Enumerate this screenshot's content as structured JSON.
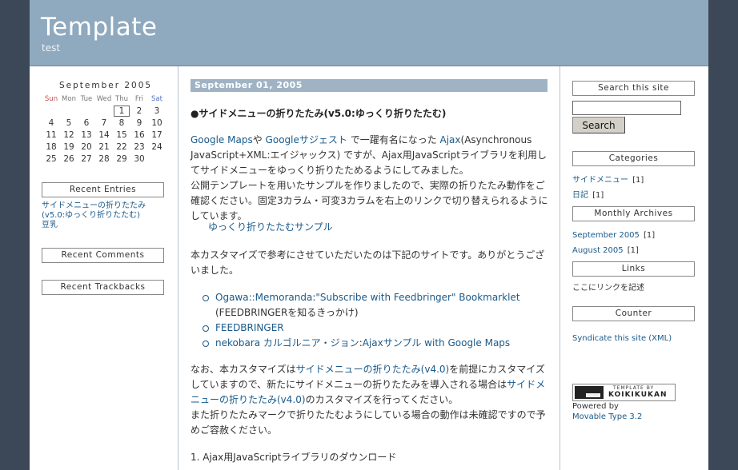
{
  "site": {
    "title": "Template",
    "description": "test"
  },
  "calendar": {
    "caption": "September 2005",
    "weekdays": [
      "Sun",
      "Mon",
      "Tue",
      "Wed",
      "Thu",
      "Fri",
      "Sat"
    ],
    "weeks": [
      [
        "",
        "",
        "",
        "",
        "1",
        "2",
        "3"
      ],
      [
        "4",
        "5",
        "6",
        "7",
        "8",
        "9",
        "10"
      ],
      [
        "11",
        "12",
        "13",
        "14",
        "15",
        "16",
        "17"
      ],
      [
        "18",
        "19",
        "20",
        "21",
        "22",
        "23",
        "24"
      ],
      [
        "25",
        "26",
        "27",
        "28",
        "29",
        "30",
        ""
      ]
    ],
    "highlighted_day": "1"
  },
  "left": {
    "recent_entries_title": "Recent Entries",
    "recent_entries": [
      "サイドメニューの折りたたみ(v5.0:ゆっくり折りたたむ)",
      "豆乳"
    ],
    "recent_comments_title": "Recent Comments",
    "recent_trackbacks_title": "Recent Trackbacks"
  },
  "post": {
    "date": "September 01, 2005",
    "title": "●サイドメニューの折りたたみ(v5.0:ゆっくり折りたたむ)",
    "p1": {
      "link1": "Google Maps",
      "t1": "や ",
      "link2": "Googleサジェスト",
      "t2": " で一躍有名になった ",
      "link3": "Ajax",
      "t3": "(Asynchronous JavaScript+XML:エイジャックス) ですが、Ajax用JavaScriptライブラリを利用してサイドメニューをゆっくり折りたためるようにしてみました。",
      "t4": "公開テンプレートを用いたサンプルを作りましたので、実際の折りたたみ動作をご確認ください。固定3カラム・可変3カラムを右上のリンクで切り替えられるようにしています。"
    },
    "sample_link": "ゆっくり折りたたむサンプル",
    "p2": "本カスタマイズで参考にさせていただいたのは下記のサイトです。ありがとうございました。",
    "refs": [
      {
        "link": "Ogawa::Memoranda",
        "sep": ":",
        "link2": "\"Subscribe with Feedbringer\" Bookmarklet",
        "note": "(FEEDBRINGERを知るきっかけ)"
      },
      {
        "link": "FEEDBRINGER",
        "sep": "",
        "link2": "",
        "note": ""
      },
      {
        "link": "nekobara カルゴルニア・ジョン",
        "sep": ":",
        "link2": "Ajaxサンプル with Google Maps",
        "note": ""
      }
    ],
    "p3": {
      "t1": "なお、本カスタマイズは",
      "link1": "サイドメニューの折りたたみ(v4.0)",
      "t2": "を前提にカスタマイズしていますので、新たにサイドメニューの折りたたみを導入される場合は",
      "link2": "サイドメニューの折りたたみ(v4.0)",
      "t3": "のカスタマイズを行ってください。",
      "t4": "また折りたたみマークで折りたたむようにしている場合の動作は未確認ですので予めご容赦ください。"
    },
    "step1": "1. Ajax用JavaScriptライブラリのダウンロード"
  },
  "right": {
    "search_title": "Search this site",
    "search_value": "",
    "search_button": "Search",
    "categories_title": "Categories",
    "categories": [
      {
        "name": "サイドメニュー",
        "count": "[1]"
      },
      {
        "name": "日記",
        "count": "[1]"
      }
    ],
    "archives_title": "Monthly Archives",
    "archives": [
      {
        "name": "September 2005",
        "count": "[1]"
      },
      {
        "name": "August 2005",
        "count": "[1]"
      }
    ],
    "links_title": "Links",
    "links_text": "ここにリンクを記述",
    "counter_title": "Counter",
    "syndicate": "Syndicate this site (XML)",
    "badge_line1": "TEMPLATE BY",
    "badge_line2": "KOIKIKUKAN",
    "powered_by": "Powered by",
    "movable_type": "Movable Type 3.2"
  }
}
